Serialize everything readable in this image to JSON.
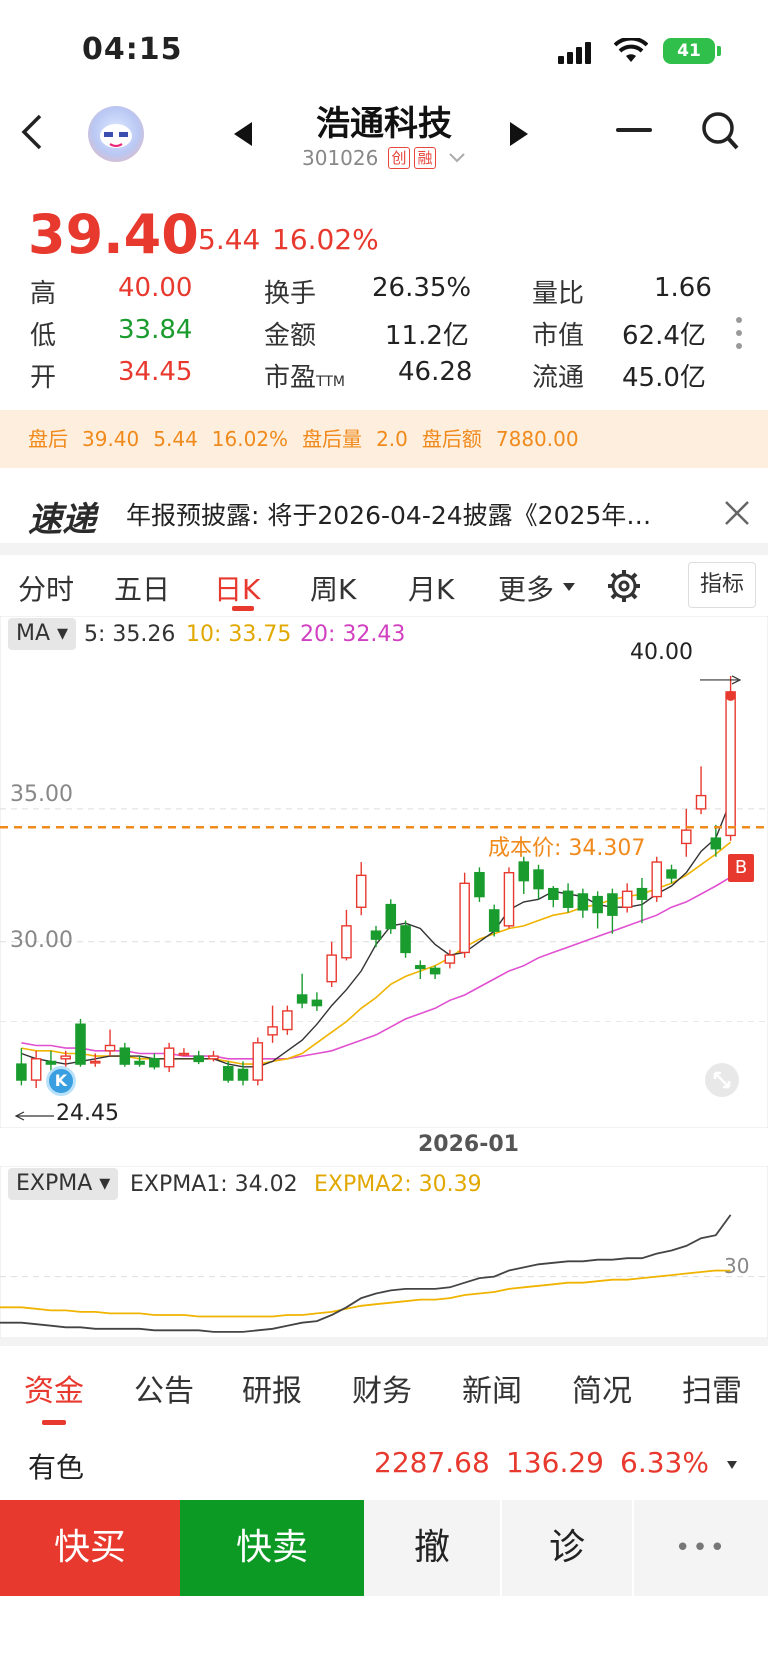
{
  "status": {
    "time": "04:15",
    "battery": "41"
  },
  "header": {
    "title": "浩通科技",
    "code": "301026",
    "tag_credit": "创",
    "tag_margin": "融"
  },
  "quote": {
    "price": "39.40",
    "change": "5.44",
    "change_pct": "16.02%",
    "rows": [
      {
        "l1": "高",
        "v1": "40.00",
        "l2": "换手",
        "v2": "26.35%",
        "l3": "量比",
        "v3": "1.66"
      },
      {
        "l1": "低",
        "v1": "33.84",
        "l2": "金额",
        "v2": "11.2亿",
        "l3": "市值",
        "v3": "62.4亿"
      },
      {
        "l1": "开",
        "v1": "34.45",
        "l2": "市盈",
        "l2sub": "TTM",
        "v2": "46.28",
        "l3": "流通",
        "v3": "45.0亿"
      }
    ]
  },
  "after_hours": {
    "label": "盘后",
    "price": "39.40",
    "change": "5.44",
    "pct": "16.02%",
    "vol_label": "盘后量",
    "vol": "2.0",
    "amt_label": "盘后额",
    "amt": "7880.00"
  },
  "news": {
    "logo": "速递",
    "text": "年报预披露: 将于2026-04-24披露《2025年…"
  },
  "ktabs": {
    "items": [
      "分时",
      "五日",
      "日K",
      "周K",
      "月K",
      "更多"
    ],
    "active": "日K",
    "indicator": "指标"
  },
  "ma_legend": {
    "pill": "MA",
    "ma5": "5: 35.26",
    "ma10": "10: 33.75",
    "ma20": "20: 32.43"
  },
  "main_chart": {
    "y_ticks": [
      "35.00",
      "30.00"
    ],
    "max_label": "40.00",
    "min_label": "24.45",
    "cost_label": "成本价: 34.307",
    "buy_marker": "B",
    "k_marker": "K",
    "date": "2026-01"
  },
  "expma_legend": {
    "pill": "EXPMA",
    "e1": "EXPMA1: 34.02",
    "e2": "EXPMA2: 30.39",
    "tick": "30"
  },
  "bottom_tabs": {
    "items": [
      "资金",
      "公告",
      "研报",
      "财务",
      "新闻",
      "简况",
      "扫雷"
    ],
    "active": "资金"
  },
  "sector": {
    "name": "有色",
    "value": "2287.68",
    "change": "136.29",
    "pct": "6.33%"
  },
  "actions": {
    "buy": "快买",
    "sell": "快卖",
    "cancel": "撤",
    "diagnose": "诊",
    "more": "•••"
  },
  "colors": {
    "up": "#e8392f",
    "down": "#1a9b2e",
    "ma5": "#333333",
    "ma10": "#f0b400",
    "ma20": "#e050d0",
    "cost": "#f08a1c"
  },
  "chart_data": {
    "type": "candlestick",
    "candles": [
      [
        25.4,
        24.8,
        26.0,
        24.6
      ],
      [
        24.8,
        25.6,
        25.9,
        24.5
      ],
      [
        25.5,
        25.4,
        25.9,
        25.0
      ],
      [
        25.6,
        25.7,
        25.9,
        25.3
      ],
      [
        26.9,
        25.4,
        27.1,
        25.3
      ],
      [
        25.5,
        25.5,
        25.8,
        25.3
      ],
      [
        25.9,
        26.1,
        26.7,
        25.7
      ],
      [
        26.0,
        25.4,
        26.2,
        25.3
      ],
      [
        25.5,
        25.4,
        25.7,
        25.3
      ],
      [
        25.6,
        25.3,
        25.8,
        25.2
      ],
      [
        25.3,
        26.0,
        26.2,
        25.1
      ],
      [
        25.8,
        25.8,
        26.0,
        25.7
      ],
      [
        25.7,
        25.5,
        25.9,
        25.4
      ],
      [
        25.6,
        25.7,
        25.9,
        25.5
      ],
      [
        25.3,
        24.8,
        25.5,
        24.7
      ],
      [
        25.2,
        24.8,
        25.5,
        24.6
      ],
      [
        24.8,
        26.2,
        26.4,
        24.6
      ],
      [
        26.5,
        26.8,
        27.6,
        26.2
      ],
      [
        26.7,
        27.4,
        27.6,
        26.5
      ],
      [
        28.0,
        27.7,
        28.8,
        27.5
      ],
      [
        27.8,
        27.6,
        28.1,
        27.4
      ],
      [
        28.5,
        29.5,
        30.0,
        28.3
      ],
      [
        29.4,
        30.6,
        31.2,
        29.3
      ],
      [
        31.3,
        32.5,
        33.0,
        31.0
      ],
      [
        30.4,
        30.1,
        30.6,
        29.8
      ],
      [
        31.4,
        30.5,
        31.6,
        30.3
      ],
      [
        30.6,
        29.6,
        30.8,
        29.4
      ],
      [
        29.1,
        29.0,
        29.3,
        28.6
      ],
      [
        29.0,
        28.8,
        29.1,
        28.6
      ],
      [
        29.2,
        29.5,
        29.7,
        29.0
      ],
      [
        29.6,
        32.2,
        32.6,
        29.4
      ],
      [
        32.6,
        31.7,
        32.8,
        31.5
      ],
      [
        31.2,
        30.4,
        31.4,
        30.2
      ],
      [
        30.6,
        32.6,
        32.8,
        30.5
      ],
      [
        33.0,
        32.3,
        33.2,
        31.8
      ],
      [
        32.7,
        32.0,
        32.9,
        31.6
      ],
      [
        32.0,
        31.6,
        32.1,
        31.3
      ],
      [
        31.9,
        31.3,
        32.2,
        31.1
      ],
      [
        31.8,
        31.2,
        32.0,
        30.9
      ],
      [
        31.7,
        31.1,
        31.9,
        30.5
      ],
      [
        31.8,
        31.0,
        32.0,
        30.3
      ],
      [
        31.3,
        31.9,
        32.2,
        31.1
      ],
      [
        32.0,
        31.6,
        32.4,
        30.7
      ],
      [
        31.7,
        33.0,
        33.2,
        31.5
      ],
      [
        32.7,
        32.4,
        32.9,
        32.2
      ],
      [
        33.7,
        34.2,
        35.0,
        33.2
      ],
      [
        35.0,
        35.5,
        36.6,
        34.8
      ],
      [
        33.9,
        33.5,
        34.4,
        33.2
      ],
      [
        34.0,
        39.4,
        40.0,
        33.8
      ]
    ],
    "ma5": [
      25.8,
      25.6,
      25.5,
      25.4,
      25.5,
      25.6,
      25.7,
      25.7,
      25.7,
      25.6,
      25.6,
      25.6,
      25.6,
      25.6,
      25.4,
      25.3,
      25.3,
      25.5,
      25.9,
      26.3,
      26.9,
      27.6,
      28.2,
      28.9,
      29.9,
      30.6,
      30.7,
      30.5,
      29.9,
      29.5,
      29.6,
      30.0,
      30.4,
      31.2,
      31.5,
      31.6,
      31.9,
      31.8,
      31.7,
      31.4,
      31.3,
      31.3,
      31.4,
      31.8,
      32.1,
      32.6,
      33.4,
      33.9,
      35.3
    ],
    "ma10": [
      26.0,
      25.9,
      25.9,
      25.8,
      25.8,
      25.7,
      25.7,
      25.7,
      25.6,
      25.6,
      25.6,
      25.6,
      25.6,
      25.6,
      25.5,
      25.4,
      25.4,
      25.5,
      25.6,
      25.8,
      26.2,
      26.6,
      27.0,
      27.5,
      27.9,
      28.4,
      28.7,
      28.9,
      29.1,
      29.4,
      29.8,
      30.1,
      30.3,
      30.5,
      30.6,
      30.8,
      31.0,
      31.1,
      31.3,
      31.4,
      31.6,
      31.7,
      31.8,
      32.0,
      32.2,
      32.5,
      32.9,
      33.3,
      33.75
    ],
    "ma20": [
      26.2,
      26.1,
      26.1,
      26.0,
      26.0,
      25.9,
      25.9,
      25.9,
      25.8,
      25.8,
      25.8,
      25.7,
      25.7,
      25.7,
      25.6,
      25.6,
      25.6,
      25.6,
      25.6,
      25.7,
      25.8,
      25.9,
      26.1,
      26.3,
      26.5,
      26.8,
      27.1,
      27.3,
      27.5,
      27.8,
      28.0,
      28.3,
      28.6,
      28.9,
      29.1,
      29.4,
      29.6,
      29.8,
      30.0,
      30.2,
      30.4,
      30.6,
      30.8,
      31.0,
      31.3,
      31.5,
      31.8,
      32.1,
      32.43
    ],
    "cost_price": 34.307,
    "ylim": [
      24.2,
      40.6
    ],
    "y_ticks": [
      35,
      30
    ],
    "expma1": [
      27.0,
      26.9,
      26.8,
      26.7,
      26.7,
      26.6,
      26.6,
      26.6,
      26.6,
      26.5,
      26.5,
      26.5,
      26.5,
      26.4,
      26.4,
      26.4,
      26.5,
      26.6,
      26.8,
      27.0,
      27.1,
      27.5,
      28.0,
      28.6,
      28.9,
      29.1,
      29.2,
      29.2,
      29.2,
      29.3,
      29.6,
      29.9,
      30.0,
      30.4,
      30.6,
      30.8,
      30.9,
      31.0,
      31.0,
      31.1,
      31.1,
      31.2,
      31.2,
      31.5,
      31.7,
      32.0,
      32.5,
      32.7,
      34.02
    ],
    "expma2": [
      28.0,
      27.9,
      27.8,
      27.8,
      27.7,
      27.7,
      27.6,
      27.6,
      27.6,
      27.5,
      27.5,
      27.5,
      27.4,
      27.4,
      27.4,
      27.4,
      27.4,
      27.4,
      27.5,
      27.5,
      27.6,
      27.7,
      27.9,
      28.1,
      28.2,
      28.3,
      28.4,
      28.5,
      28.5,
      28.6,
      28.8,
      28.9,
      29.0,
      29.2,
      29.3,
      29.4,
      29.5,
      29.6,
      29.6,
      29.7,
      29.8,
      29.8,
      29.9,
      30.0,
      30.1,
      30.2,
      30.3,
      30.4,
      30.39
    ],
    "expma_ylim": [
      26.0,
      34.6
    ]
  }
}
